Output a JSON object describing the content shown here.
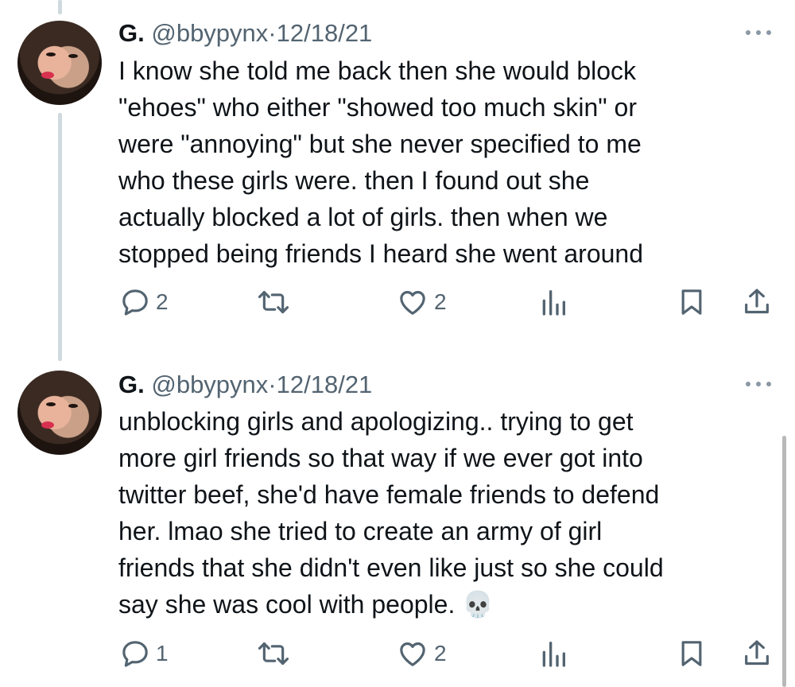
{
  "tweets": [
    {
      "name": "G.",
      "handle": "@bbypynx",
      "separator": "·",
      "date": "12/18/21",
      "lines": [
        "I know she told me back then she would block",
        "\"ehoes\" who either \"showed too much skin\" or",
        "were \"annoying\" but she never specified to me",
        "who these girls were. then I found out she",
        "actually blocked a lot of girls. then when we",
        "stopped being friends I heard she went around"
      ],
      "replies": "2",
      "likes": "2"
    },
    {
      "name": "G.",
      "handle": "@bbypynx",
      "separator": "·",
      "date": "12/18/21",
      "lines": [
        "unblocking girls and apologizing.. trying to get",
        "more girl friends so that way if we ever got into",
        "twitter beef, she'd have female friends to defend",
        "her. lmao she tried to create an army of girl",
        "friends that she didn't even like just so she could",
        "say she was cool with people. 💀"
      ],
      "replies": "1",
      "likes": "2"
    }
  ],
  "icons": {
    "reply": "reply-icon",
    "retweet": "retweet-icon",
    "like": "like-icon",
    "views": "views-icon",
    "bookmark": "bookmark-icon",
    "share": "share-icon",
    "more": "more-icon"
  },
  "colors": {
    "text": "#0f1419",
    "secondary": "#536471",
    "thread_line": "#cfd9de"
  }
}
